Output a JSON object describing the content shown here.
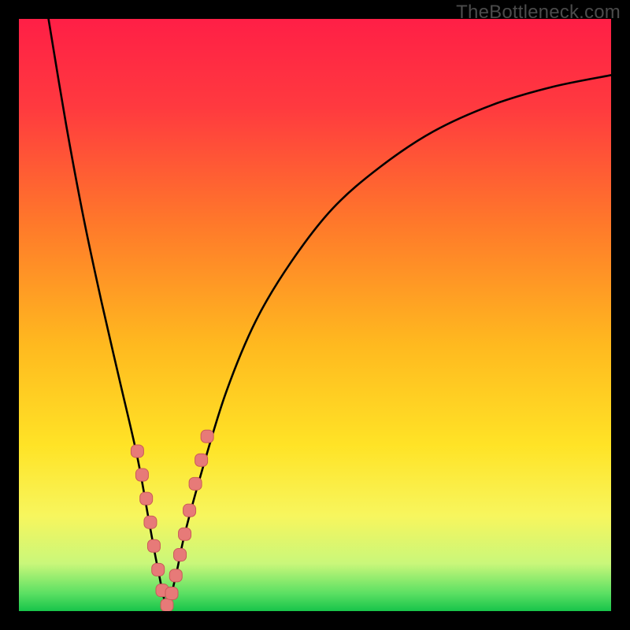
{
  "watermark": "TheBottleneck.com",
  "colors": {
    "gradient_stops": [
      {
        "offset": 0.0,
        "color": "#ff1f46"
      },
      {
        "offset": 0.15,
        "color": "#ff3a3f"
      },
      {
        "offset": 0.35,
        "color": "#ff7a2a"
      },
      {
        "offset": 0.55,
        "color": "#ffb91f"
      },
      {
        "offset": 0.72,
        "color": "#ffe326"
      },
      {
        "offset": 0.84,
        "color": "#f7f65e"
      },
      {
        "offset": 0.92,
        "color": "#c9f77a"
      },
      {
        "offset": 0.97,
        "color": "#5be063"
      },
      {
        "offset": 1.0,
        "color": "#17c44a"
      }
    ],
    "curve": "#000000",
    "marker_fill": "#e77a78",
    "marker_stroke": "#c95a58",
    "frame_bg": "#000000"
  },
  "chart_data": {
    "type": "line",
    "title": "",
    "xlabel": "",
    "ylabel": "",
    "xlim": [
      0,
      100
    ],
    "ylim": [
      0,
      100
    ],
    "notch_x": 25,
    "series": [
      {
        "name": "bottleneck-curve",
        "x": [
          5,
          8,
          11,
          14,
          17,
          20,
          22,
          23.5,
          25,
          26.5,
          28,
          31,
          35,
          40,
          46,
          53,
          61,
          70,
          80,
          90,
          100
        ],
        "y": [
          100,
          82,
          66,
          52,
          39,
          26,
          15,
          7,
          1,
          6,
          13,
          24,
          37,
          49,
          59,
          68,
          75,
          81,
          85.5,
          88.5,
          90.5
        ]
      }
    ],
    "markers": {
      "name": "highlight-points",
      "x": [
        20,
        20.8,
        21.5,
        22.2,
        22.8,
        23.5,
        24.2,
        25,
        25.8,
        26.5,
        27.2,
        28,
        28.8,
        29.8,
        30.8,
        31.8
      ],
      "y": [
        27,
        23,
        19,
        15,
        11,
        7,
        3.5,
        1,
        3,
        6,
        9.5,
        13,
        17,
        21.5,
        25.5,
        29.5
      ]
    }
  }
}
